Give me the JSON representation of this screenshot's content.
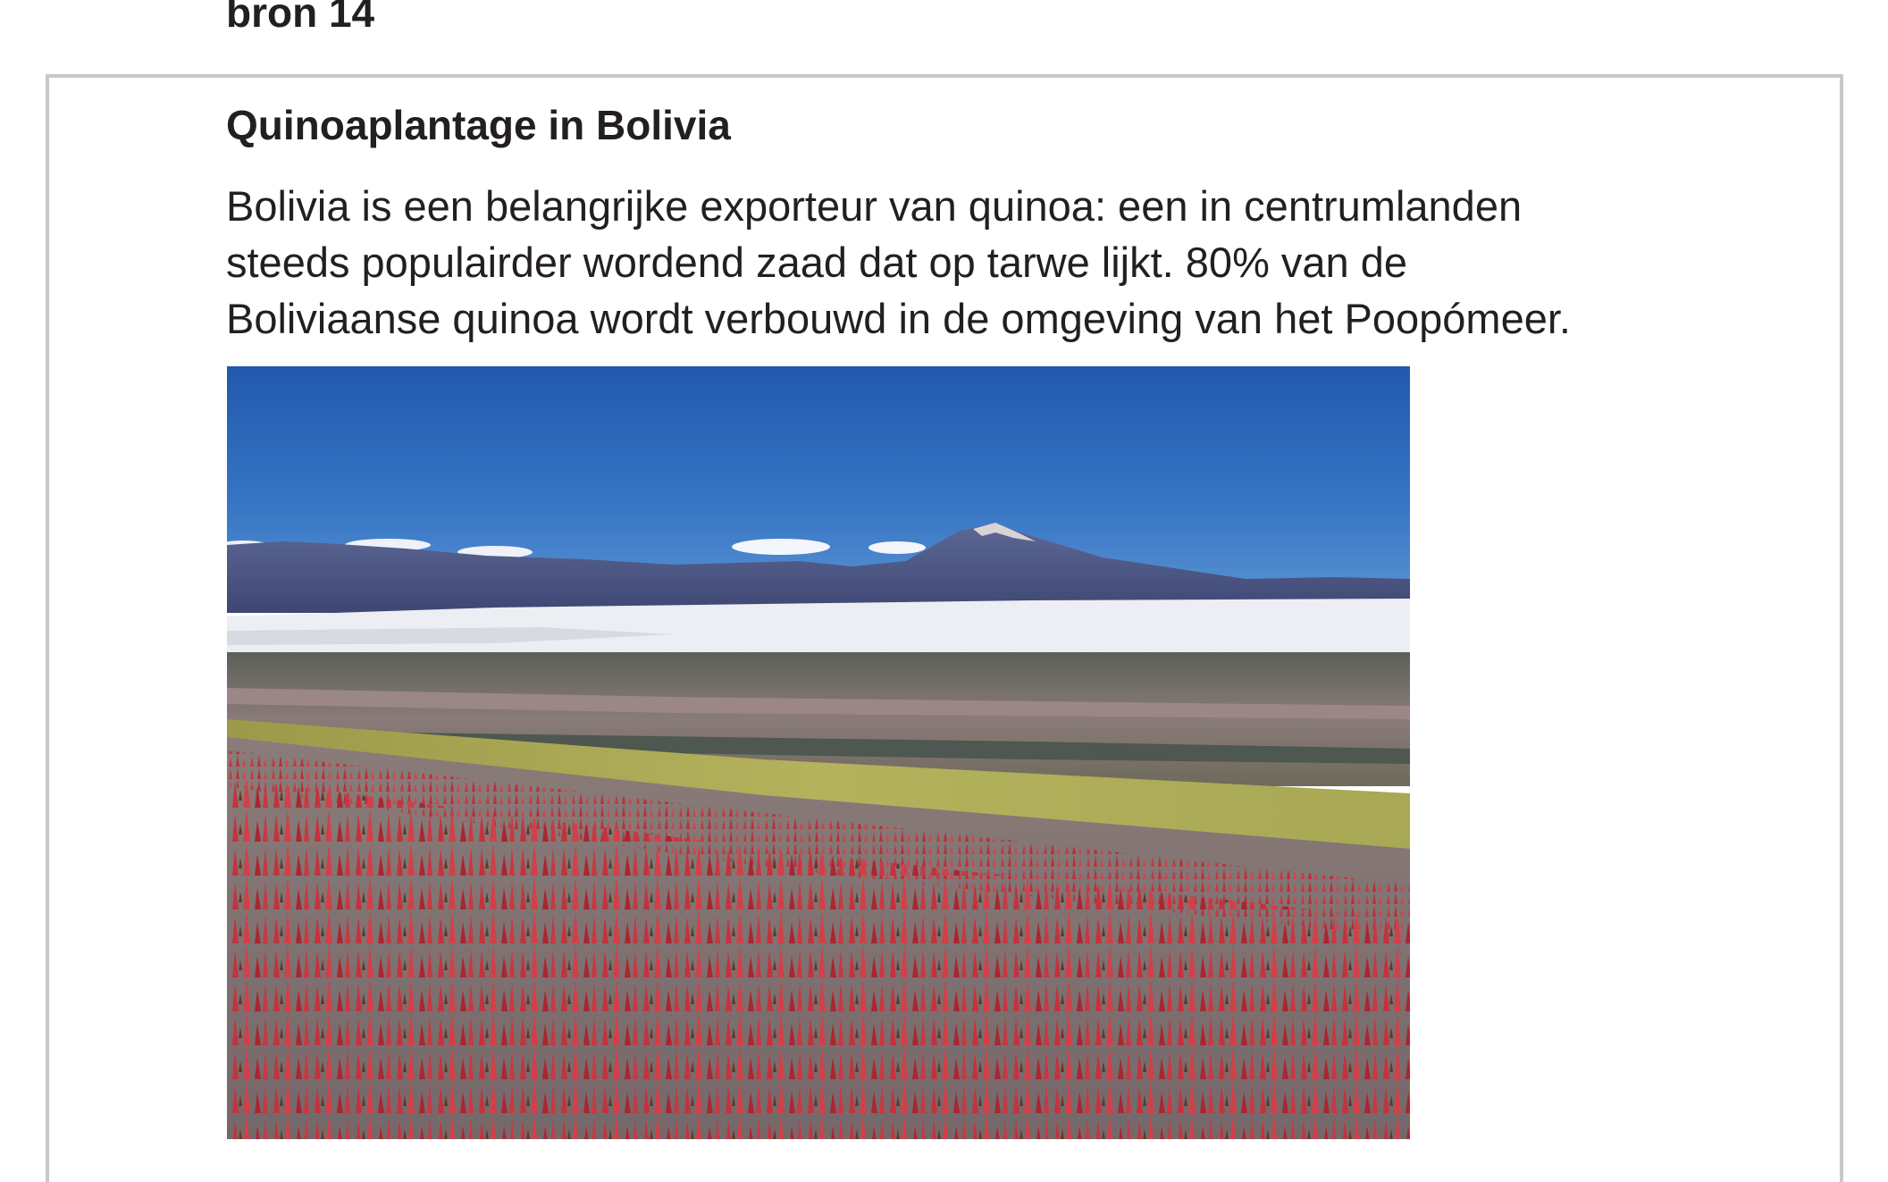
{
  "source": {
    "label": "bron 14"
  },
  "box": {
    "title": "Quinoaplantage in Bolivia",
    "text_lines": [
      "Bolivia is een belangrijke exporteur van quinoa: een in centrumlanden",
      "steeds populairder wordend zaad dat op tarwe lijkt. 80% van de",
      "Boliviaanse quinoa wordt verbouwd in de omgeving van het Poopómeer."
    ]
  },
  "colors": {
    "text": "#231f20",
    "border": "#c8c8c8",
    "sky": "#2f67b7",
    "salt_flat": "#eeeef2",
    "quinoa": "#c0303a"
  }
}
